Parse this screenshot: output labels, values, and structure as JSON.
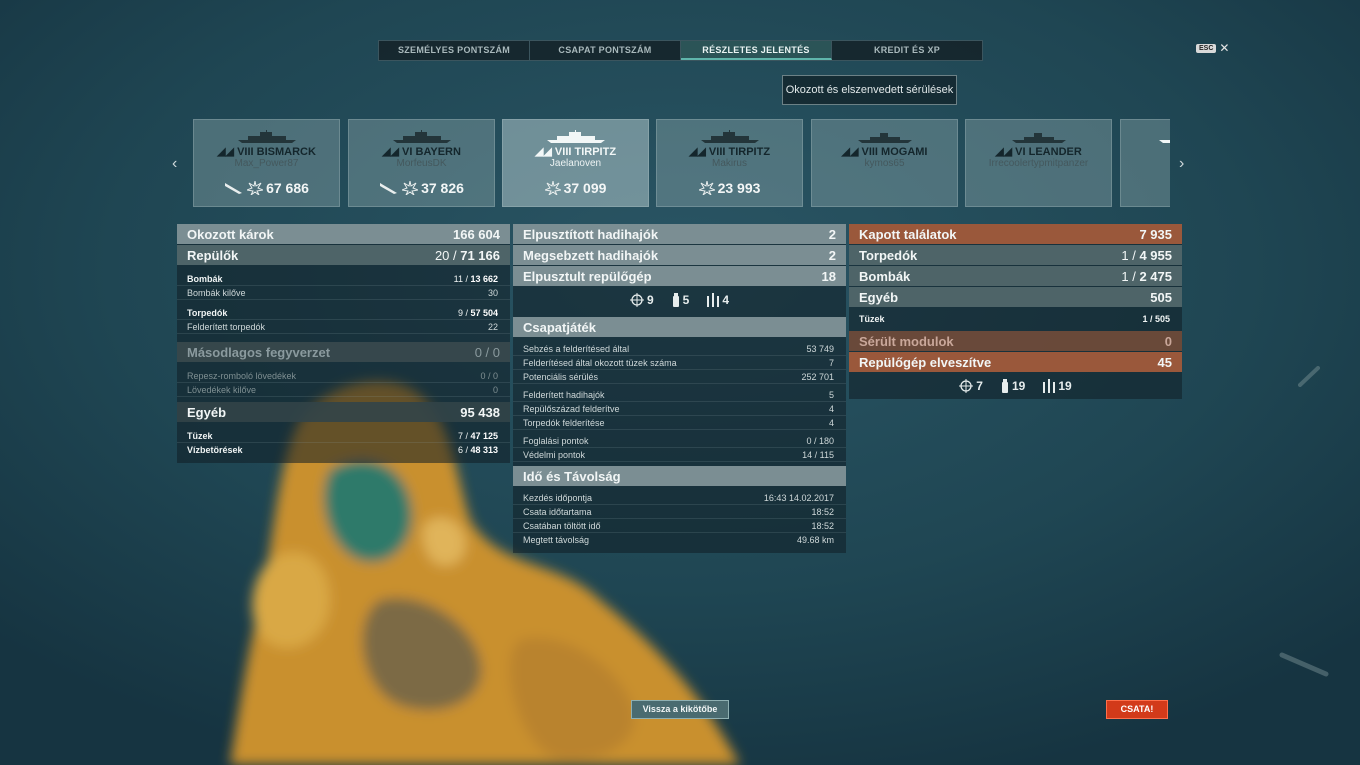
{
  "tabs": [
    {
      "label": "SZEMÉLYES PONTSZÁM",
      "active": false
    },
    {
      "label": "CSAPAT PONTSZÁM",
      "active": false
    },
    {
      "label": "RÉSZLETES JELENTÉS",
      "active": true
    },
    {
      "label": "KREDIT ÉS XP",
      "active": false
    }
  ],
  "esc_label": "ESC",
  "close_glyph": "✕",
  "damage_button": "Okozott és elszenvedett sérülések",
  "arrows": {
    "left": "‹",
    "right": "›"
  },
  "ships": [
    {
      "tier_name": "VIII BISMARCK",
      "player": "Max_Power87",
      "score": "67 686",
      "selected": false,
      "plane_icon": true
    },
    {
      "tier_name": "VI BAYERN",
      "player": "MorfeusDK",
      "score": "37 826",
      "selected": false,
      "plane_icon": true
    },
    {
      "tier_name": "VIII TIRPITZ",
      "player": "Jaelanoven",
      "score": "37 099",
      "selected": true,
      "plane_icon": false
    },
    {
      "tier_name": "VIII TIRPITZ",
      "player": "Makirus",
      "score": "23 993",
      "selected": false,
      "plane_icon": false
    },
    {
      "tier_name": "VIII MOGAMI",
      "player": "kymos65",
      "score": "",
      "selected": false,
      "plane_icon": false
    },
    {
      "tier_name": "VI LEANDER",
      "player": "Irrecoolertypmitpanzer",
      "score": "",
      "selected": false,
      "plane_icon": false
    },
    {
      "tier_name": "",
      "player": "",
      "score": "",
      "selected": false,
      "plane_icon": false
    }
  ],
  "left": {
    "damage": {
      "label": "Okozott károk",
      "value": "166 604"
    },
    "planes": {
      "label": "Repülők",
      "value_a": "20 / ",
      "value_b": "71 166"
    },
    "bombs": {
      "label": "Bombák",
      "value_a": "11 / ",
      "value_b": "13 662"
    },
    "bombs_fired": {
      "label": "Bombák kilőve",
      "value": "30"
    },
    "torpedoes": {
      "label": "Torpedók",
      "value_a": "9 / ",
      "value_b": "57 504"
    },
    "spotted_torpedoes": {
      "label": "Felderített torpedók",
      "value": "22"
    },
    "secondary": {
      "label": "Másodlagos fegyverzet",
      "value": "0 / 0"
    },
    "he_shells": {
      "label": "Repesz-romboló lövedékek",
      "value": "0 / 0"
    },
    "shells_fired": {
      "label": "Lövedékek kilőve",
      "value": "0"
    },
    "other": {
      "label": "Egyéb",
      "value": "95 438"
    },
    "fires": {
      "label": "Tüzek",
      "value_a": "7 / ",
      "value_b": "47 125"
    },
    "flooding": {
      "label": "Vízbetörések",
      "value_a": "6 / ",
      "value_b": "48 313"
    }
  },
  "middle": {
    "destroyed_ships": {
      "label": "Elpusztított hadihajók",
      "value": "2"
    },
    "damaged_ships": {
      "label": "Megsebzett hadihajók",
      "value": "2"
    },
    "destroyed_planes": {
      "label": "Elpusztult repülőgép",
      "value": "18"
    },
    "hit_icons": {
      "main": "9",
      "torpedo": "5",
      "secondary": "4"
    },
    "teamplay": {
      "title": "Csapatjáték",
      "rows": [
        {
          "label": "Sebzés a felderítésed által",
          "value": "53 749"
        },
        {
          "label": "Felderítésed által okozott tüzek száma",
          "value": "7"
        },
        {
          "label": "Potenciális sérülés",
          "value": "252 701"
        },
        {
          "label": "Felderített hadihajók",
          "value": "5"
        },
        {
          "label": "Repülőszázad felderítve",
          "value": "4"
        },
        {
          "label": "Torpedók felderítése",
          "value": "4"
        },
        {
          "label": "Foglalási pontok",
          "value": "0 / 180"
        },
        {
          "label": "Védelmi pontok",
          "value": "14 / 115"
        }
      ]
    },
    "time": {
      "title": "Idő és Távolság",
      "rows": [
        {
          "label": "Kezdés időpontja",
          "value": "16:43  14.02.2017"
        },
        {
          "label": "Csata időtartama",
          "value": "18:52"
        },
        {
          "label": "Csatában töltött idő",
          "value": "18:52"
        },
        {
          "label": "Megtett távolság",
          "value": "49.68 km"
        }
      ]
    }
  },
  "right": {
    "hits_taken": {
      "label": "Kapott találatok",
      "value": "7 935"
    },
    "torpedoes": {
      "label": "Torpedók",
      "value_a": "1 / ",
      "value_b": "4 955"
    },
    "bombs": {
      "label": "Bombák",
      "value_a": "1 / ",
      "value_b": "2 475"
    },
    "other": {
      "label": "Egyéb",
      "value": "505"
    },
    "fires": {
      "label": "Tüzek",
      "value": "1 / 505"
    },
    "damaged_modules": {
      "label": "Sérült modulok",
      "value": "0"
    },
    "planes_lost": {
      "label": "Repülőgép elveszítve",
      "value": "45"
    },
    "hit_icons": {
      "main": "7",
      "torpedo": "19",
      "secondary": "19"
    }
  },
  "buttons": {
    "back": "Vissza a kikötőbe",
    "battle": "CSATA!"
  }
}
